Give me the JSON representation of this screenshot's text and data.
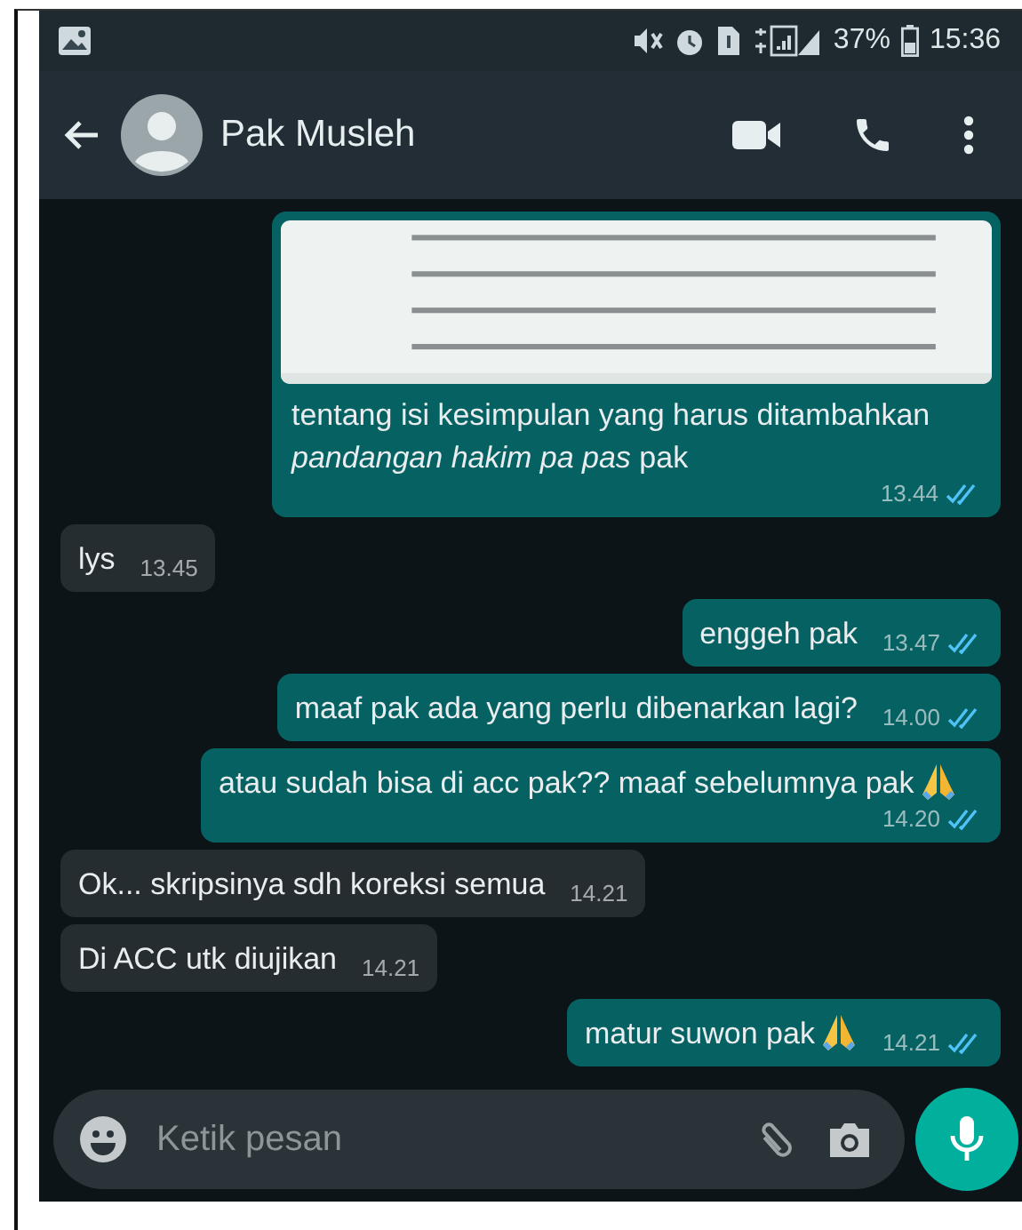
{
  "status_bar": {
    "battery": "37%",
    "time": "15:36"
  },
  "header": {
    "contact_name": "Pak Musleh"
  },
  "messages": [
    {
      "outgoing": true,
      "text": "tentang isi kesimpulan yang harus ditambahkan *pandangan hakim pa pas* pak",
      "time": "13.44",
      "read": true,
      "emoji": false
    },
    {
      "kind": "text",
      "outgoing": false,
      "text": "lys",
      "time": "13.45",
      "emoji": false
    },
    {
      "kind": "text",
      "outgoing": true,
      "text": "enggeh pak",
      "time": "13.47",
      "read": true,
      "emoji": false
    },
    {
      "kind": "text",
      "outgoing": true,
      "text": "maaf pak ada yang perlu dibenarkan lagi?",
      "time": "14.00",
      "read": true,
      "emoji": false
    },
    {
      "kind": "text",
      "outgoing": true,
      "text": "atau sudah bisa di acc pak?? maaf sebelumnya pak",
      "time": "14.20",
      "read": true,
      "emoji": true
    },
    {
      "kind": "text",
      "outgoing": false,
      "text": "Ok... skripsinya sdh koreksi semua",
      "time": "14.21",
      "emoji": false
    },
    {
      "kind": "text",
      "outgoing": false,
      "text": "Di ACC utk diujikan",
      "time": "14.21",
      "emoji": false
    },
    {
      "kind": "text",
      "outgoing": true,
      "text": "matur suwon pak",
      "time": "14.21",
      "read": true,
      "emoji": true
    }
  ],
  "composer": {
    "placeholder": "Ketik pesan"
  }
}
